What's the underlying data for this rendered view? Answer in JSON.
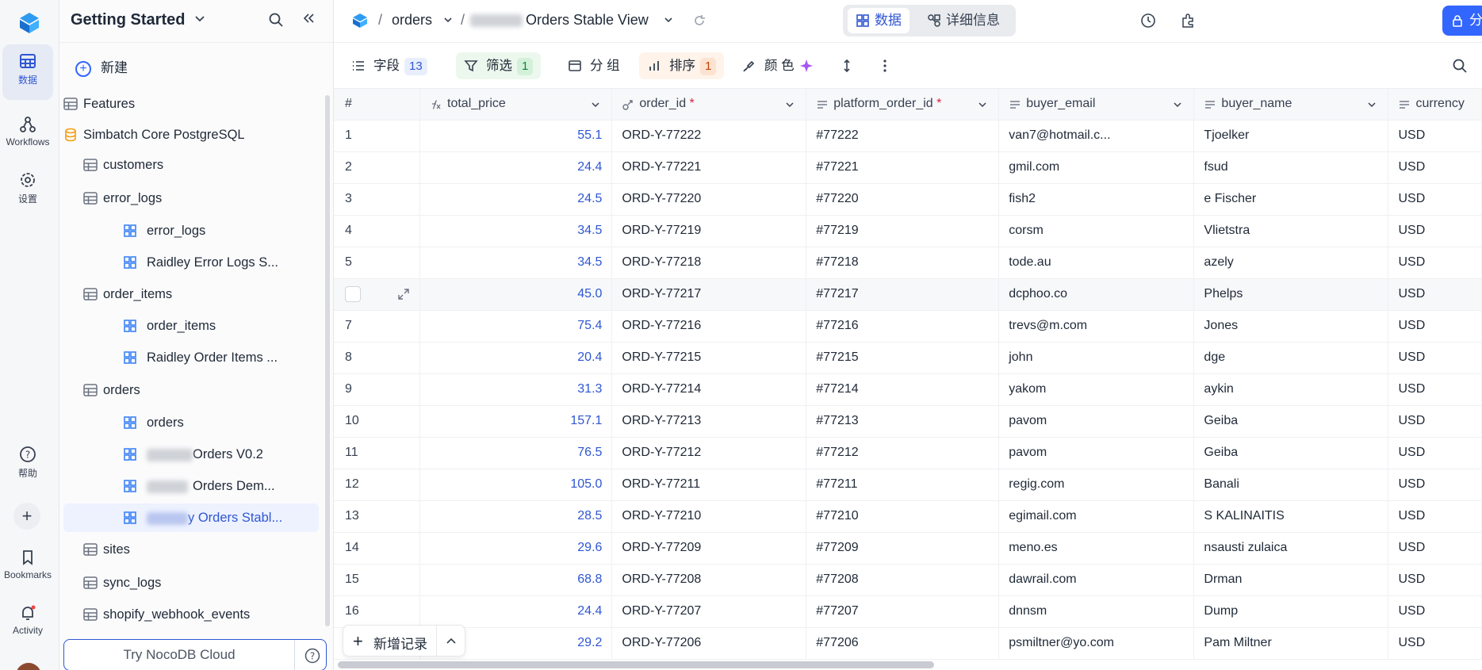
{
  "rail": {
    "items": [
      {
        "label": "数据",
        "icon": "grid-icon"
      },
      {
        "label": "Workflows",
        "icon": "workflow-icon"
      },
      {
        "label": "设置",
        "icon": "gear-icon"
      },
      {
        "label": "帮助",
        "icon": "help-icon"
      },
      {
        "label": "Bookmarks",
        "icon": "bookmark-icon"
      },
      {
        "label": "Activity",
        "icon": "bell-icon"
      }
    ]
  },
  "sidebar": {
    "workspace_title": "Getting Started",
    "new_label": "新建",
    "items": [
      {
        "label": "Features",
        "type": "table"
      },
      {
        "label": "Simbatch Core PostgreSQL",
        "type": "database"
      },
      {
        "label": "customers",
        "type": "table"
      },
      {
        "label": "error_logs",
        "type": "table"
      },
      {
        "label": "error_logs",
        "type": "view"
      },
      {
        "label": "Raidley Error Logs S...",
        "type": "view"
      },
      {
        "label": "order_items",
        "type": "table"
      },
      {
        "label": "order_items",
        "type": "view"
      },
      {
        "label": "Raidley Order Items ...",
        "type": "view"
      },
      {
        "label": "orders",
        "type": "table"
      },
      {
        "label": "orders",
        "type": "view"
      },
      {
        "label": "Orders V0.2",
        "type": "view"
      },
      {
        "label": "Orders Dem...",
        "type": "view"
      },
      {
        "label": "y Orders Stabl...",
        "type": "view"
      },
      {
        "label": "sites",
        "type": "table"
      },
      {
        "label": "sync_logs",
        "type": "table"
      },
      {
        "label": "shopify_webhook_events",
        "type": "table"
      }
    ],
    "cloud_button": "Try NocoDB Cloud"
  },
  "topbar": {
    "crumb_table": "orders",
    "crumb_view": "Orders Stable View",
    "tab_data": "数据",
    "tab_details": "详细信息",
    "share_label": "分"
  },
  "toolbar": {
    "fields_label": "字段",
    "fields_count": "13",
    "filter_label": "筛选",
    "filter_count": "1",
    "group_label": "分 组",
    "sort_label": "排序",
    "sort_count": "1",
    "color_label": "颜 色"
  },
  "grid": {
    "columns": [
      {
        "label": "#",
        "required": false
      },
      {
        "label": "total_price",
        "required": false
      },
      {
        "label": "order_id",
        "required": true
      },
      {
        "label": "platform_order_id",
        "required": true
      },
      {
        "label": "buyer_email",
        "required": false
      },
      {
        "label": "buyer_name",
        "required": false
      },
      {
        "label": "currency",
        "required": false
      }
    ],
    "rows": [
      {
        "n": "1",
        "price": "55.1",
        "order_id": "ORD-Y-77222",
        "pid": "#77222",
        "email": "van7@hotmail.c...",
        "name": "Tjoelker",
        "cur": "USD"
      },
      {
        "n": "2",
        "price": "24.4",
        "order_id": "ORD-Y-77221",
        "pid": "#77221",
        "email": "gmil.com",
        "name": "fsud",
        "cur": "USD"
      },
      {
        "n": "3",
        "price": "24.5",
        "order_id": "ORD-Y-77220",
        "pid": "#77220",
        "email": "fish2",
        "name": "e Fischer",
        "cur": "USD"
      },
      {
        "n": "4",
        "price": "34.5",
        "order_id": "ORD-Y-77219",
        "pid": "#77219",
        "email": "corsm",
        "name": "Vlietstra",
        "cur": "USD"
      },
      {
        "n": "5",
        "price": "34.5",
        "order_id": "ORD-Y-77218",
        "pid": "#77218",
        "email": "tode.au",
        "name": "azely",
        "cur": "USD"
      },
      {
        "n": "",
        "price": "45.0",
        "order_id": "ORD-Y-77217",
        "pid": "#77217",
        "email": "dcphoo.co",
        "name": "Phelps",
        "cur": "USD"
      },
      {
        "n": "7",
        "price": "75.4",
        "order_id": "ORD-Y-77216",
        "pid": "#77216",
        "email": "trevs@m.com",
        "name": "Jones",
        "cur": "USD"
      },
      {
        "n": "8",
        "price": "20.4",
        "order_id": "ORD-Y-77215",
        "pid": "#77215",
        "email": "john",
        "name": "dge",
        "cur": "USD"
      },
      {
        "n": "9",
        "price": "31.3",
        "order_id": "ORD-Y-77214",
        "pid": "#77214",
        "email": "yakom",
        "name": "aykin",
        "cur": "USD"
      },
      {
        "n": "10",
        "price": "157.1",
        "order_id": "ORD-Y-77213",
        "pid": "#77213",
        "email": "pavom",
        "name": "Geiba",
        "cur": "USD"
      },
      {
        "n": "11",
        "price": "76.5",
        "order_id": "ORD-Y-77212",
        "pid": "#77212",
        "email": "pavom",
        "name": "Geiba",
        "cur": "USD"
      },
      {
        "n": "12",
        "price": "105.0",
        "order_id": "ORD-Y-77211",
        "pid": "#77211",
        "email": "regig.com",
        "name": "Banali",
        "cur": "USD"
      },
      {
        "n": "13",
        "price": "28.5",
        "order_id": "ORD-Y-77210",
        "pid": "#77210",
        "email": "egimail.com",
        "name": "S KALINAITIS",
        "cur": "USD"
      },
      {
        "n": "14",
        "price": "29.6",
        "order_id": "ORD-Y-77209",
        "pid": "#77209",
        "email": "meno.es",
        "name": "nsausti zulaica",
        "cur": "USD"
      },
      {
        "n": "15",
        "price": "68.8",
        "order_id": "ORD-Y-77208",
        "pid": "#77208",
        "email": "dawrail.com",
        "name": "Drman",
        "cur": "USD"
      },
      {
        "n": "16",
        "price": "24.4",
        "order_id": "ORD-Y-77207",
        "pid": "#77207",
        "email": "dnnsm",
        "name": "Dump",
        "cur": "USD"
      },
      {
        "n": "",
        "price": "29.2",
        "order_id": "ORD-Y-77206",
        "pid": "#77206",
        "email": "psmiltner@yo.com",
        "name": "Pam Miltner",
        "cur": "USD"
      }
    ]
  },
  "footer": {
    "new_record": "新增记录"
  },
  "colors": {
    "accent": "#3366ff",
    "accent_text": "#2f57d3",
    "required": "#e11d48",
    "filter_bg": "#ecf8ee",
    "sort_bg": "#fff3ea"
  }
}
